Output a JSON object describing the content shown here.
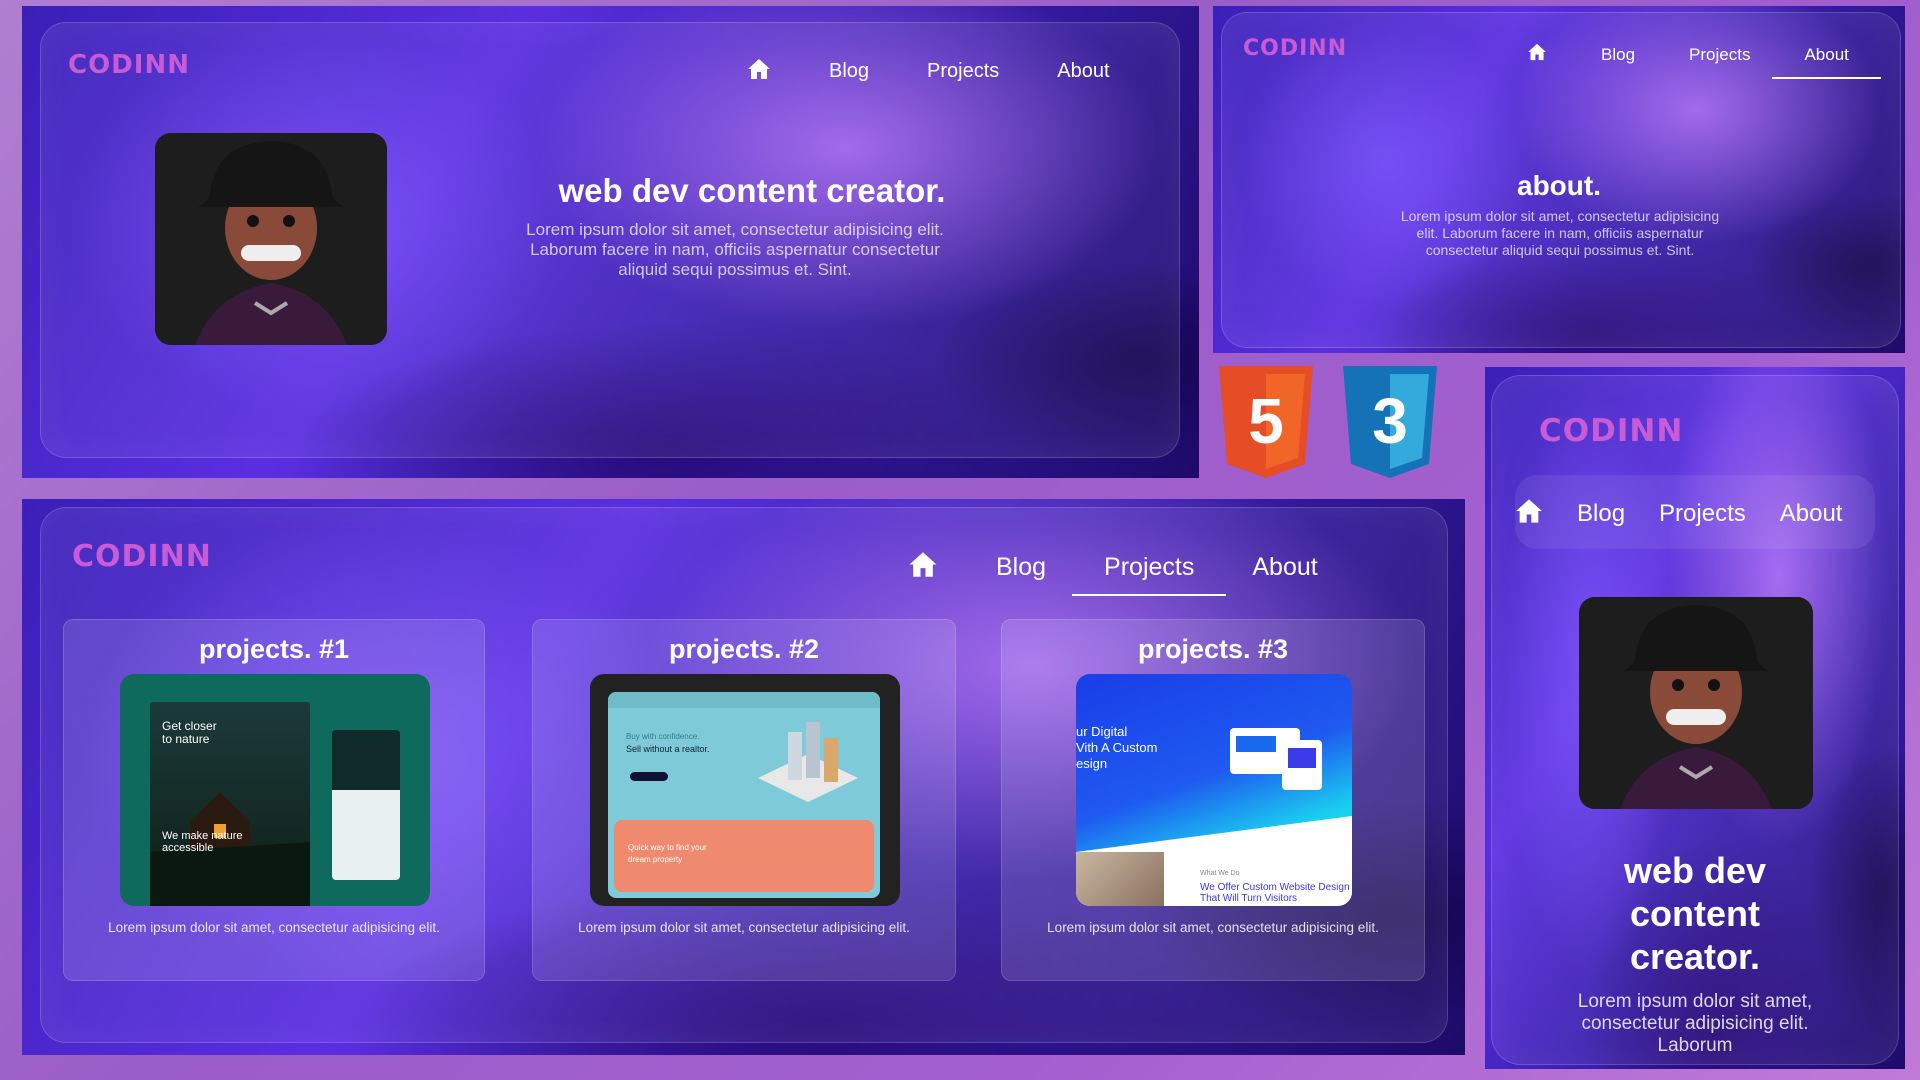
{
  "logo": "CODINN",
  "nav": {
    "home_icon": "home-icon",
    "blog": "Blog",
    "projects": "Projects",
    "about": "About"
  },
  "hero": {
    "title": "web dev content creator.",
    "text": "Lorem ipsum dolor sit amet, consectetur adipisicing elit. Laborum facere in nam, officiis aspernatur consectetur aliquid sequi possimus et. Sint."
  },
  "about": {
    "title": "about.",
    "text": "Lorem ipsum dolor sit amet, consectetur adipisicing elit. Laborum facere in nam, officiis aspernatur consectetur aliquid sequi possimus et. Sint."
  },
  "projects": [
    {
      "title": "projects. #1",
      "text": "Lorem ipsum dolor sit amet, consectetur adipisicing elit.",
      "thumb": {
        "heading": "Get closer to nature",
        "tagline": "We make nature accessible"
      }
    },
    {
      "title": "projects. #2",
      "text": "Lorem ipsum dolor sit amet, consectetur adipisicing elit.",
      "thumb": {
        "kicker": "Buy with confidence.",
        "heading": "Sell without a realtor.",
        "banner": "Quick way to find your dream property"
      }
    },
    {
      "title": "projects. #3",
      "text": "Lorem ipsum dolor sit amet, consectetur adipisicing elit.",
      "thumb": {
        "heading_1": "ur Digital",
        "heading_2": "Vith A Custom",
        "heading_3": "esign",
        "sub_kicker": "What We Do",
        "subheading": "We Offer Custom Website Design That Will Turn Visitors"
      }
    }
  ],
  "mobile": {
    "title": "web dev content creator.",
    "text": "Lorem ipsum dolor sit amet, consectetur adipisicing elit. Laborum"
  },
  "badges": {
    "html": "5",
    "css": "3"
  },
  "colors": {
    "logo": "#c95bd6",
    "html5": "#e44d26",
    "css3": "#1572b6",
    "bg": "#a467cc"
  }
}
